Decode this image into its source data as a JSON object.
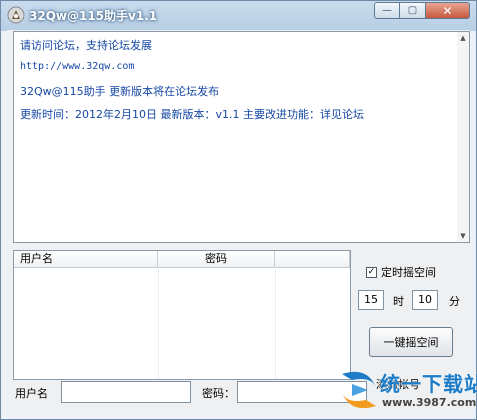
{
  "window": {
    "title": "32Qw@115助手v1.1",
    "minimize_glyph": "—",
    "maximize_glyph": "▢",
    "close_glyph": "✕"
  },
  "info": {
    "lines": [
      "请访问论坛，支持论坛发展",
      "http://www.32qw.com",
      "32Qw@115助手 更新版本将在论坛发布",
      "更新时间：2012年2月10日    最新版本：v1.1   主要改进功能：详见论坛"
    ],
    "text_color": "#1648a5"
  },
  "table": {
    "headers": [
      "用户名",
      "密码",
      ""
    ],
    "rows": []
  },
  "timer": {
    "checkbox_label": "定时摇空间",
    "checked": true,
    "hour_value": "15",
    "hour_label": "时",
    "minute_value": "10",
    "minute_label": "分"
  },
  "shake_button_label": "一键摇空间",
  "form": {
    "username_label": "用户名",
    "username_value": "",
    "password_label": "密码：",
    "password_value": "",
    "add_button_label": "添加帐号"
  },
  "watermark": {
    "text": "统一下载站",
    "url": "www.3987.com"
  },
  "icons": {
    "app": "app-logo-icon",
    "checkbox_mark": "✓"
  }
}
